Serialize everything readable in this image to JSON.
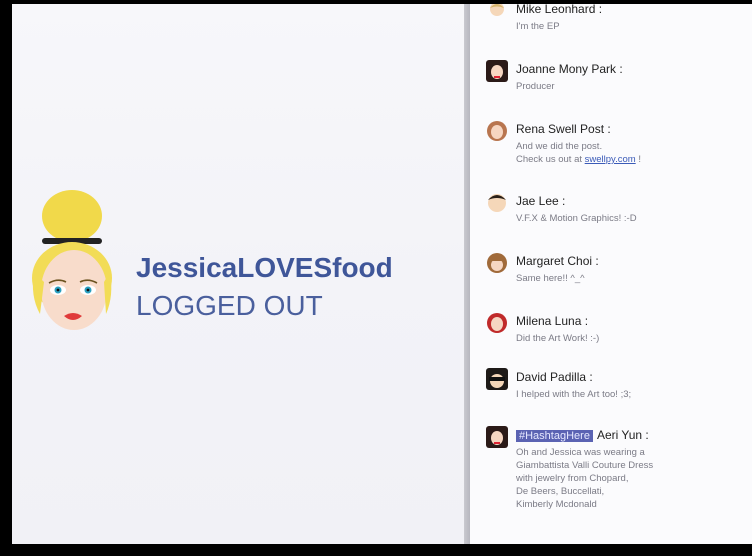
{
  "profile": {
    "username": "JessicaLOVESfood",
    "status": "LOGGED OUT",
    "avatar_icon": "blonde-woman-avatar-icon",
    "colors": {
      "username": "#3f5699",
      "status": "#4a5f9d"
    }
  },
  "chat": {
    "messages": [
      {
        "name": "Mike Leonhard :",
        "lines": [
          "I'm the EP"
        ],
        "avatar_icon": "man-avatar-icon"
      },
      {
        "name": "Joanne Mony Park :",
        "lines": [
          "Producer"
        ],
        "avatar_icon": "woman-dark-hair-avatar-icon"
      },
      {
        "name": "Rena Swell Post :",
        "lines": [
          "And we did the post.",
          "Check us out at",
          "swellpy.com",
          "!"
        ],
        "avatar_icon": "woman-brown-hair-avatar-icon"
      },
      {
        "name": "Jae Lee :",
        "lines": [
          "V.F.X & Motion Graphics! :-D"
        ],
        "avatar_icon": "man-avatar-icon"
      },
      {
        "name": "Margaret Choi :",
        "lines": [
          "Same here!! ^_^"
        ],
        "avatar_icon": "woman-bangs-avatar-icon"
      },
      {
        "name": "Milena Luna :",
        "lines": [
          "Did the Art Work! :-)"
        ],
        "avatar_icon": "woman-red-avatar-icon"
      },
      {
        "name": "David Padilla :",
        "lines": [
          "I helped with the Art too! ;3;"
        ],
        "avatar_icon": "man-sunglasses-avatar-icon"
      },
      {
        "tag": "#HashtagHere",
        "name": "Aeri Yun :",
        "lines": [
          "Oh and Jessica was wearing a",
          "Giambattista Valli Couture Dress",
          "with jewelry from Chopard,",
          "De Beers, Buccellati,",
          "Kimberly Mcdonald"
        ],
        "avatar_icon": "woman-dark-hair-avatar-icon"
      }
    ]
  }
}
